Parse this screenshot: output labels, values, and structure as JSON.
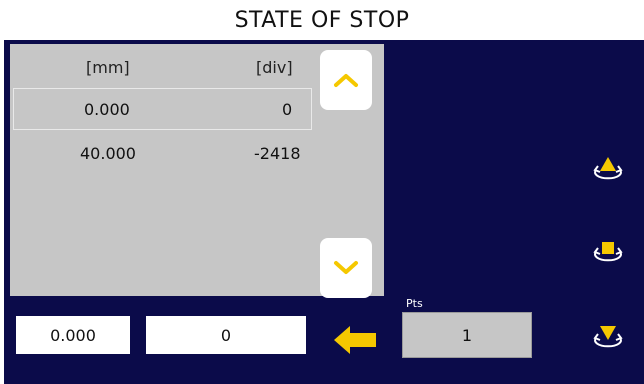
{
  "title": "STATE OF STOP",
  "table": {
    "headers": [
      "[mm]",
      "[div]"
    ],
    "rows": [
      {
        "mm": "0.000",
        "div": "0"
      },
      {
        "mm": "40.000",
        "div": "-2418"
      }
    ]
  },
  "inputs": {
    "mm_value": "0.000",
    "div_value": "0"
  },
  "points": {
    "label": "Pts",
    "value": "1"
  },
  "colors": {
    "background": "#0b0b4a",
    "accent": "#f5c800",
    "table_bg": "#c6c6c6"
  },
  "icons": {
    "scroll_up": "chevron-up-icon",
    "scroll_down": "chevron-down-icon",
    "enter": "arrow-left-icon",
    "rotate_up": "rotate-up-icon",
    "rotate_stop": "rotate-stop-icon",
    "rotate_down": "rotate-down-icon"
  }
}
